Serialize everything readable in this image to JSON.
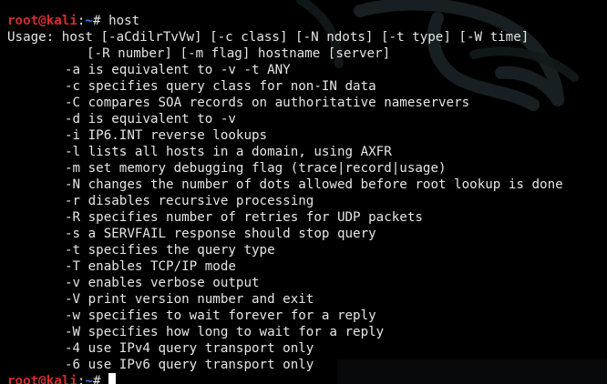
{
  "colors": {
    "background": "#000000",
    "text": "#e5e5e5",
    "prompt_user": "#d12c2c",
    "prompt_path": "#3b82f6",
    "cursor": "#ffffff"
  },
  "prompt": {
    "user_host": "root@kali",
    "separator": ":",
    "path": "~",
    "symbol": "# "
  },
  "command": "host",
  "usage": {
    "line1": "Usage: host [-aCdilrTvVw] [-c class] [-N ndots] [-t type] [-W time]",
    "line2": "[-R number] [-m flag] hostname [server]"
  },
  "options": [
    {
      "text": "-a is equivalent to -v -t ANY"
    },
    {
      "text": "-c specifies query class for non-IN data"
    },
    {
      "text": "-C compares SOA records on authoritative nameservers"
    },
    {
      "text": "-d is equivalent to -v"
    },
    {
      "text": "-i IP6.INT reverse lookups"
    },
    {
      "text": "-l lists all hosts in a domain, using AXFR"
    },
    {
      "text": "-m set memory debugging flag (trace|record|usage)"
    },
    {
      "text": "-N changes the number of dots allowed before root lookup is done"
    },
    {
      "text": "-r disables recursive processing"
    },
    {
      "text": "-R specifies number of retries for UDP packets"
    },
    {
      "text": "-s a SERVFAIL response should stop query"
    },
    {
      "text": "-t specifies the query type"
    },
    {
      "text": "-T enables TCP/IP mode"
    },
    {
      "text": "-v enables verbose output"
    },
    {
      "text": "-V print version number and exit"
    },
    {
      "text": "-w specifies to wait forever for a reply"
    },
    {
      "text": "-W specifies how long to wait for a reply"
    },
    {
      "text": "-4 use IPv4 query transport only"
    },
    {
      "text": "-6 use IPv6 query transport only"
    }
  ],
  "background_art": "kali-dragon-watermark"
}
